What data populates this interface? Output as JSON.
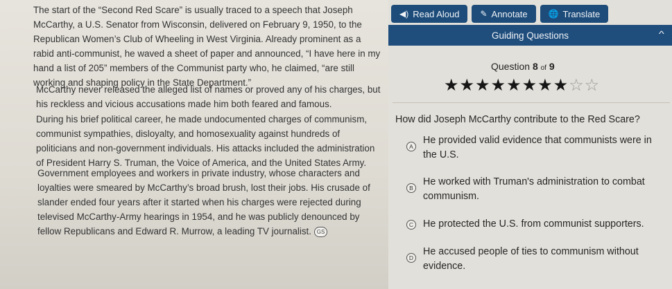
{
  "passage": {
    "paragraphs": [
      "The start of the “Second Red Scare” is usually traced to a speech that Joseph McCarthy, a U.S. Senator from Wisconsin, delivered on February 9, 1950, to the Republican Women’s Club of Wheeling in West Virginia. Already prominent as a rabid anti-communist, he waved a sheet of paper and announced, “I have here in my hand a list of 205” members of the Communist party who, he claimed, “are still working and shaping policy in the State Department.”",
      "McCarthy never released the alleged list of names or proved any of his charges, but his reckless and vicious accusations made him both feared and famous.",
      "During his brief political career, he made undocumented charges of communism, communist sympathies, disloyalty, and homosexuality against hundreds of politicians and non-government individuals. His attacks included the administration of President Harry S. Truman, the Voice of America, and the United States Army.",
      "Government employees and workers in private industry, whose characters and loyalties were smeared by McCarthy’s broad brush, lost their jobs. His crusade of slander ended four years after it started when his charges were rejected during televised McCarthy-Army hearings in 1954, and he was publicly denounced by fellow Republicans and Edward R. Murrow, a leading TV journalist."
    ],
    "footnote_marker": "GS"
  },
  "toolbar": {
    "read_aloud": "Read Aloud",
    "annotate": "Annotate",
    "translate": "Translate",
    "read_aloud_icon": "speaker-icon",
    "annotate_icon": "pencil-icon",
    "translate_icon": "globe-icon"
  },
  "guiding": {
    "label": "Guiding Questions",
    "question_label": "Question",
    "current": "8",
    "of_label": "of",
    "total": "9",
    "stars_filled": 8,
    "stars_total": 10
  },
  "question": {
    "text": "How did Joseph McCarthy contribute to the Red Scare?",
    "options": [
      {
        "letter": "A",
        "text": "He provided valid evidence that communists were in the U.S."
      },
      {
        "letter": "B",
        "text": "He worked with Truman's administration to combat communism."
      },
      {
        "letter": "C",
        "text": "He protected the U.S. from communist supporters."
      },
      {
        "letter": "D",
        "text": "He accused people of ties to communism without evidence."
      }
    ]
  },
  "colors": {
    "toolbar_bg": "#1d4c7a",
    "guide_bar_bg": "#1f4d7c",
    "star_filled": "#161616",
    "star_empty": "#9a9893"
  }
}
